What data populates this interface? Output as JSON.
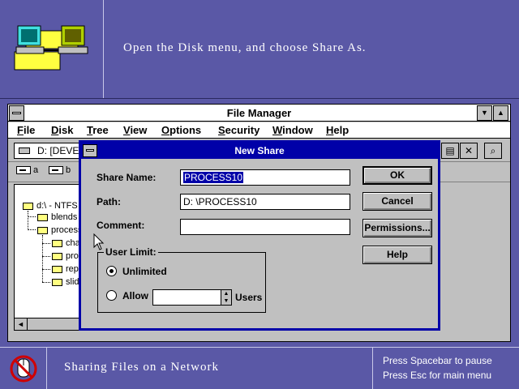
{
  "tutorial": {
    "instruction": "Open the Disk menu, and choose Share As.",
    "footer_title": "Sharing Files on a Network",
    "hint_pause": "Press Spacebar to pause",
    "hint_menu": "Press Esc for main menu",
    "banner_icon": "network-computers-icon",
    "footer_icon": "no-mouse-icon"
  },
  "file_manager": {
    "title": "File Manager",
    "menu": [
      "File",
      "Disk",
      "Tree",
      "View",
      "Options",
      "Security",
      "Window",
      "Help"
    ],
    "drive_combo": "D: [DEVE",
    "drives": [
      "a",
      "b"
    ],
    "tree": {
      "root": "d:\\ - NTFS",
      "items": [
        "blends",
        "process",
        "cha",
        "prop",
        "repo",
        "slide"
      ]
    }
  },
  "dialog": {
    "title": "New Share",
    "share_name_label": "Share Name:",
    "share_name_value": "PROCESS10",
    "path_label": "Path:",
    "path_value": "D: \\PROCESS10",
    "comment_label": "Comment:",
    "comment_value": "",
    "user_limit_label": "User Limit:",
    "unlimited_label": "Unlimited",
    "allow_label": "Allow",
    "users_label": "Users",
    "allow_value": "",
    "selected_limit": "Unlimited",
    "buttons": {
      "ok": "OK",
      "cancel": "Cancel",
      "permissions": "Permissions...",
      "help": "Help"
    }
  },
  "colors": {
    "background": "#5a58a6",
    "dialog_title": "#0000a8",
    "window_face": "#c0c0c0"
  }
}
